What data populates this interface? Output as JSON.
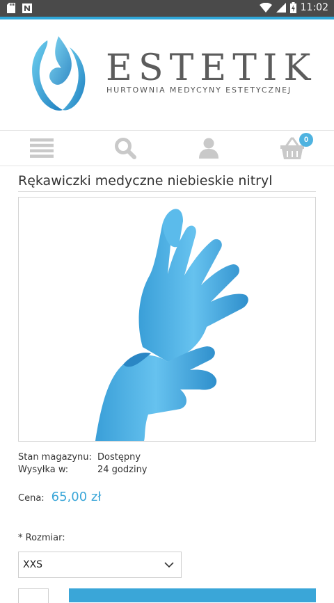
{
  "statusbar": {
    "time": "11:02"
  },
  "brand": {
    "name": "ESTETIK",
    "tagline": "HURTOWNIA MEDYCYNY ESTETYCZNEJ"
  },
  "nav": {
    "cart_count": "0"
  },
  "product": {
    "title": "Rękawiczki medyczne niebieskie nitryl",
    "stock_label": "Stan magazynu:",
    "stock_value": "Dostępny",
    "shipping_label": "Wysyłka w:",
    "shipping_value": "24 godziny",
    "price_label": "Cena:",
    "price": "65,00 zł",
    "size_label": "* Rozmiar:",
    "size_selected": "XXS"
  },
  "colors": {
    "accent": "#3aa6d8",
    "statusbar": "#4a4a4a"
  }
}
